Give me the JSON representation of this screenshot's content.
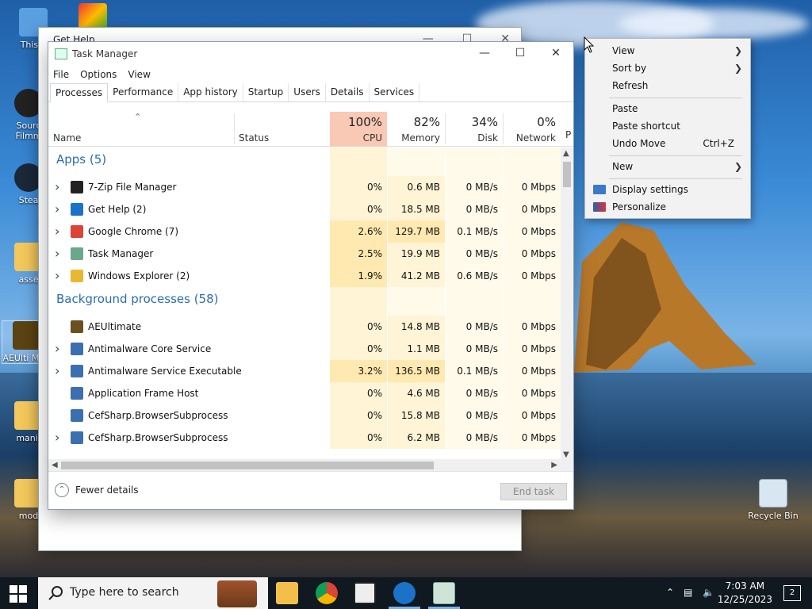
{
  "desktop": {
    "icons": [
      {
        "label": "This P"
      },
      {
        "label": "Sourc Filmm"
      },
      {
        "label": "Stea"
      },
      {
        "label": "asse"
      },
      {
        "label": "AEUlti MPG"
      },
      {
        "label": "manif"
      },
      {
        "label": "mod"
      },
      {
        "label": "Recycle Bin"
      }
    ]
  },
  "get_help_window": {
    "title": "Get Help"
  },
  "task_manager": {
    "title": "Task Manager",
    "menu": [
      "File",
      "Options",
      "View"
    ],
    "tabs": [
      "Processes",
      "Performance",
      "App history",
      "Startup",
      "Users",
      "Details",
      "Services"
    ],
    "active_tab": "Processes",
    "columns": {
      "name": "Name",
      "status": "Status",
      "cpu": {
        "pct": "100%",
        "label": "CPU"
      },
      "memory": {
        "pct": "82%",
        "label": "Memory"
      },
      "disk": {
        "pct": "34%",
        "label": "Disk"
      },
      "network": {
        "pct": "0%",
        "label": "Network"
      },
      "power_partial": "P"
    },
    "groups": [
      {
        "title": "Apps (5)",
        "rows": [
          {
            "name": "7-Zip File Manager",
            "cpu": "0%",
            "mem": "0.6 MB",
            "disk": "0 MB/s",
            "net": "0 Mbps",
            "icon": "7zip-icon",
            "color": "#222222",
            "expand": true
          },
          {
            "name": "Get Help (2)",
            "cpu": "0%",
            "mem": "18.5 MB",
            "disk": "0 MB/s",
            "net": "0 Mbps",
            "icon": "get-help-icon",
            "color": "#1a73c8",
            "expand": true
          },
          {
            "name": "Google Chrome (7)",
            "cpu": "2.6%",
            "mem": "129.7 MB",
            "disk": "0.1 MB/s",
            "net": "0 Mbps",
            "icon": "chrome-icon",
            "color": "#db4437",
            "expand": true
          },
          {
            "name": "Task Manager",
            "cpu": "2.5%",
            "mem": "19.9 MB",
            "disk": "0 MB/s",
            "net": "0 Mbps",
            "icon": "task-manager-icon",
            "color": "#6aa88e",
            "expand": true
          },
          {
            "name": "Windows Explorer (2)",
            "cpu": "1.9%",
            "mem": "41.2 MB",
            "disk": "0.6 MB/s",
            "net": "0 Mbps",
            "icon": "folder-icon",
            "color": "#e8b830",
            "expand": true
          }
        ]
      },
      {
        "title": "Background processes (58)",
        "rows": [
          {
            "name": "AEUltimate",
            "cpu": "0%",
            "mem": "14.8 MB",
            "disk": "0 MB/s",
            "net": "0 Mbps",
            "icon": "aeultimate-icon",
            "color": "#6b4f1d",
            "expand": false
          },
          {
            "name": "Antimalware Core Service",
            "cpu": "0%",
            "mem": "1.1 MB",
            "disk": "0 MB/s",
            "net": "0 Mbps",
            "icon": "service-icon",
            "color": "#3c6fb0",
            "expand": true
          },
          {
            "name": "Antimalware Service Executable",
            "cpu": "3.2%",
            "mem": "136.5 MB",
            "disk": "0.1 MB/s",
            "net": "0 Mbps",
            "icon": "service-icon",
            "color": "#3c6fb0",
            "expand": true
          },
          {
            "name": "Application Frame Host",
            "cpu": "0%",
            "mem": "4.6 MB",
            "disk": "0 MB/s",
            "net": "0 Mbps",
            "icon": "service-icon",
            "color": "#3c6fb0",
            "expand": false
          },
          {
            "name": "CefSharp.BrowserSubprocess",
            "cpu": "0%",
            "mem": "15.8 MB",
            "disk": "0 MB/s",
            "net": "0 Mbps",
            "icon": "service-icon",
            "color": "#3c6fb0",
            "expand": false
          },
          {
            "name": "CefSharp.BrowserSubprocess",
            "cpu": "0%",
            "mem": "6.2 MB",
            "disk": "0 MB/s",
            "net": "0 Mbps",
            "icon": "service-icon",
            "color": "#3c6fb0",
            "expand": true
          }
        ]
      }
    ],
    "footer": {
      "fewer_details": "Fewer details",
      "end_task": "End task"
    },
    "colors": {
      "cpu_header": "#f9c9b5",
      "cell_light": "#fff4d6",
      "cell_mid": "#ffe9b0",
      "cell_pale": "#fffaea"
    }
  },
  "context_menu": {
    "items": [
      {
        "label": "View",
        "submenu": true
      },
      {
        "label": "Sort by",
        "submenu": true
      },
      {
        "label": "Refresh"
      },
      {
        "label": "Paste"
      },
      {
        "label": "Paste shortcut"
      },
      {
        "label": "Undo Move",
        "shortcut": "Ctrl+Z"
      },
      {
        "label": "New",
        "submenu": true
      },
      {
        "label": "Display settings",
        "icon": "display-settings-icon"
      },
      {
        "label": "Personalize",
        "icon": "personalize-icon"
      }
    ]
  },
  "taskbar": {
    "search_placeholder": "Type here to search",
    "clock_time": "7:03 AM",
    "clock_date": "12/25/2023",
    "notification_count": "2"
  }
}
